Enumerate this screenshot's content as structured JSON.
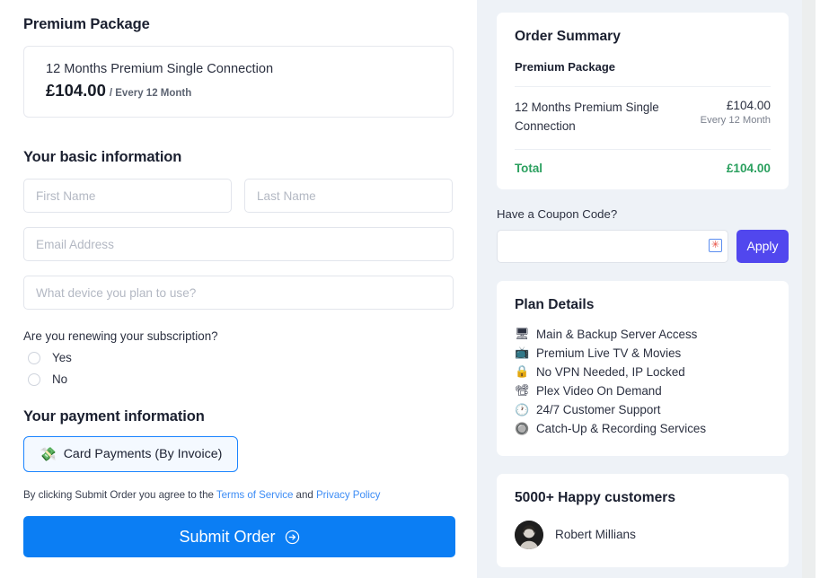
{
  "left": {
    "package_title": "Premium Package",
    "package_box": {
      "name": "12 Months Premium Single Connection",
      "price": "£104.00",
      "cycle": "/ Every 12 Month"
    },
    "basic_info_title": "Your basic information",
    "fields": {
      "first_name_placeholder": "First Name",
      "first_name_value": "",
      "last_name_placeholder": "Last Name",
      "last_name_value": "",
      "email_placeholder": "Email Address",
      "email_value": "",
      "device_placeholder": "What device you plan to use?",
      "device_value": ""
    },
    "renewal_question": "Are you renewing your subscription?",
    "renewal_options": [
      "Yes",
      "No"
    ],
    "payment_title": "Your payment information",
    "payment_option": {
      "label": "Card Payments (By Invoice)",
      "icon": "money-with-wings-icon",
      "emoji": "💸",
      "selected": true,
      "border_color": "#1b84ff"
    },
    "terms": {
      "prefix": "By clicking Submit Order you agree to the ",
      "link1": "Terms of Service",
      "middle": " and ",
      "link2": "Privacy Policy",
      "link_color": "#3c8cf5"
    },
    "submit_label": "Submit Order",
    "submit_icon": "arrow-circle-right-icon",
    "submit_color": "#0b7ef4"
  },
  "sidebar": {
    "order_summary": {
      "title": "Order Summary",
      "package": "Premium Package",
      "line_item": {
        "name": "12 Months Premium Single Connection",
        "price": "£104.00",
        "cycle": "Every 12 Month"
      },
      "total_label": "Total",
      "total_value": "£104.00",
      "total_color": "#2ba05f"
    },
    "coupon": {
      "question": "Have a Coupon Code?",
      "input_value": "",
      "input_placeholder": "",
      "required_icon": "required-field-icon",
      "required_glyph": "✳",
      "apply_label": "Apply",
      "apply_color": "#5147ee"
    },
    "plan_details": {
      "title": "Plan Details",
      "items": [
        {
          "emoji": "🖥",
          "icon": "desktop-computer-icon",
          "label": "Main & Backup Server Access"
        },
        {
          "emoji": "📺",
          "icon": "television-icon",
          "label": "Premium Live TV & Movies"
        },
        {
          "emoji": "🔒",
          "icon": "lock-icon",
          "label": "No VPN Needed, IP Locked"
        },
        {
          "emoji": "📽",
          "icon": "film-projector-icon",
          "label": "Plex Video On Demand"
        },
        {
          "emoji": "🕐",
          "icon": "clock-icon",
          "label": "24/7 Customer Support"
        },
        {
          "emoji": "🔘",
          "icon": "record-button-icon",
          "label": "Catch-Up & Recording Services"
        }
      ]
    },
    "testimonial": {
      "title": "5000+ Happy customers",
      "name": "Robert Millians",
      "avatar": "customer-avatar"
    }
  }
}
